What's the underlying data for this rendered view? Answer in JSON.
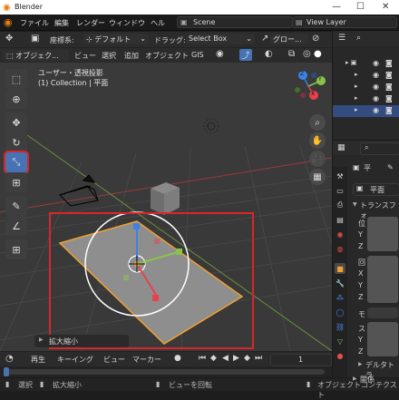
{
  "window": {
    "title": "Blender",
    "minimize": "—",
    "maximize": "☐",
    "close": "✕"
  },
  "menu": {
    "items": [
      "ファイル",
      "編集",
      "レンダー",
      "ウィンドウ",
      "ヘル"
    ],
    "scene": "Scene",
    "view_layer": "View Layer"
  },
  "header": {
    "orientation_label": "座標系:",
    "orientation_value": "デフォルト",
    "drag_label": "ドラッグ:",
    "drag_value": "Select Box",
    "global_value": "グロー...",
    "mode": "オブジェク...",
    "view_menu": [
      "ビュー",
      "選択",
      "追加",
      "オブジェクト",
      "GIS"
    ]
  },
  "viewport": {
    "view_name": "ユーザー・透視投影",
    "collection_info": "(1) Collection | 平面",
    "operator_panel": "拡大縮小",
    "axes": {
      "x": "X",
      "y": "Y",
      "z": "Z"
    }
  },
  "timeline": {
    "items": [
      "再生",
      "キーイング",
      "ビュー",
      "マーカー"
    ],
    "frame": "1"
  },
  "status": {
    "select": "選択",
    "scale": "拡大縮小",
    "rotate_view": "ビューを回転",
    "object_context": "オブジェクトコンテクスト"
  },
  "properties": {
    "object_name": "平",
    "mesh_name": "平面",
    "section_transform": "トランスフォ",
    "row_labels": [
      "位",
      "Y",
      "Z",
      "回",
      "X",
      "Y",
      "Z",
      "モ",
      "ス",
      "Y",
      "Z"
    ],
    "delta_transform": "デルタトラ",
    "relations": "関係"
  },
  "colors": {
    "accent": "#4772b3",
    "selection_orange": "#f0a030",
    "highlight_red": "#d9262b",
    "x_axis": "#e8404e",
    "y_axis": "#8bc34a",
    "z_axis": "#3b82e8"
  }
}
